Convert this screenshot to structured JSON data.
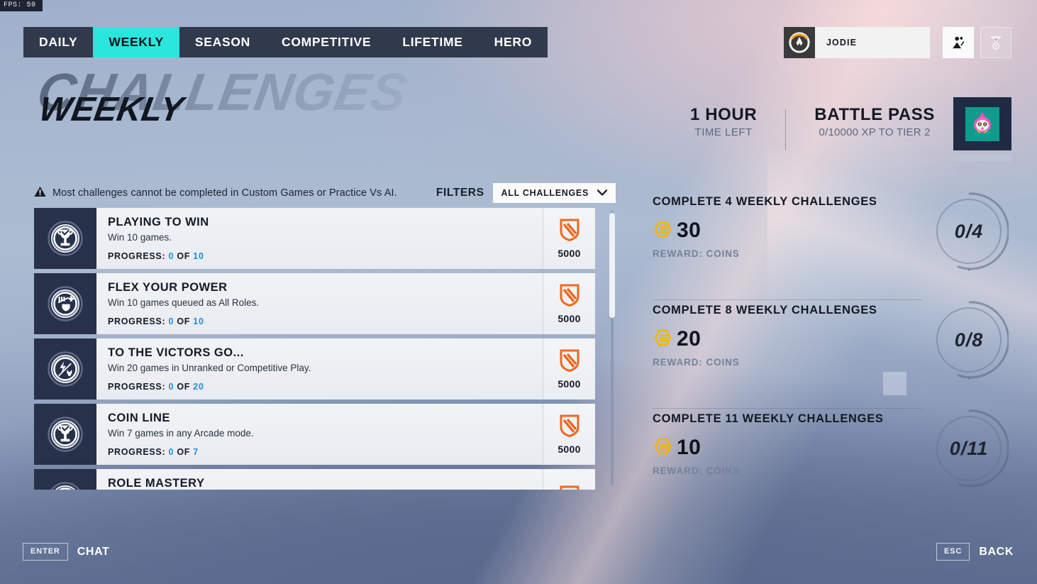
{
  "hud": {
    "fps_label": "FPS:",
    "fps_value": "59"
  },
  "tabs": [
    {
      "label": "DAILY",
      "active": false
    },
    {
      "label": "WEEKLY",
      "active": true
    },
    {
      "label": "SEASON",
      "active": false
    },
    {
      "label": "COMPETITIVE",
      "active": false
    },
    {
      "label": "LIFETIME",
      "active": false
    },
    {
      "label": "HERO",
      "active": false
    }
  ],
  "player": {
    "name": "JODIE",
    "logo_icon": "overwatch-logo-icon",
    "social_icon": "social-group-icon",
    "endorsement_icon": "endorsement-icon"
  },
  "title": {
    "ghost": "CHALLENGES",
    "main": "WEEKLY"
  },
  "header_right": {
    "time_value": "1 HOUR",
    "time_label": "TIME LEFT",
    "battlepass_title": "BATTLE PASS",
    "battlepass_sub": "0/10000 XP TO TIER 2"
  },
  "notice": {
    "icon": "warning-triangle-icon",
    "text": "Most challenges cannot be completed in Custom Games or Practice Vs AI."
  },
  "filters": {
    "label": "FILTERS",
    "selected": "ALL CHALLENGES",
    "chevron_icon": "chevron-down-icon"
  },
  "challenges": [
    {
      "icon": "trophy-icon",
      "title": "PLAYING TO WIN",
      "desc": "Win 10 games.",
      "progress_label": "PROGRESS:",
      "progress_current": "0",
      "progress_of": "OF",
      "progress_total": "10",
      "reward_icon": "xp-shield-icon",
      "reward_value": "5000"
    },
    {
      "icon": "all-roles-icon",
      "title": "FLEX YOUR POWER",
      "desc": "Win 10 games queued as All Roles.",
      "progress_label": "PROGRESS:",
      "progress_current": "0",
      "progress_of": "OF",
      "progress_total": "10",
      "reward_icon": "xp-shield-icon",
      "reward_value": "5000"
    },
    {
      "icon": "competitive-bolt-icon",
      "title": "TO THE VICTORS GO...",
      "desc": "Win 20 games in Unranked or Competitive Play.",
      "progress_label": "PROGRESS:",
      "progress_current": "0",
      "progress_of": "OF",
      "progress_total": "20",
      "reward_icon": "xp-shield-icon",
      "reward_value": "5000"
    },
    {
      "icon": "trophy-icon",
      "title": "COIN LINE",
      "desc": "Win 7 games in any Arcade mode.",
      "progress_label": "PROGRESS:",
      "progress_current": "0",
      "progress_of": "OF",
      "progress_total": "7",
      "reward_icon": "xp-shield-icon",
      "reward_value": "5000"
    },
    {
      "icon": "trophy-icon",
      "title": "ROLE MASTERY",
      "desc": "",
      "progress_label": "PROGRESS:",
      "progress_current": "",
      "progress_of": "",
      "progress_total": "",
      "reward_icon": "xp-shield-icon",
      "reward_value": ""
    }
  ],
  "reward_tiers": [
    {
      "title": "COMPLETE 4 WEEKLY CHALLENGES",
      "coin_icon": "coin-icon",
      "amount": "30",
      "reward_label": "REWARD:  COINS",
      "fraction": "0/4"
    },
    {
      "title": "COMPLETE 8 WEEKLY CHALLENGES",
      "coin_icon": "coin-icon",
      "amount": "20",
      "reward_label": "REWARD:  COINS",
      "fraction": "0/8"
    },
    {
      "title": "COMPLETE 11 WEEKLY CHALLENGES",
      "coin_icon": "coin-icon",
      "amount": "10",
      "reward_label": "REWARD:  COINS",
      "fraction": "0/11"
    }
  ],
  "footer": {
    "chat_key": "ENTER",
    "chat_label": "CHAT",
    "back_key": "ESC",
    "back_label": "BACK"
  },
  "colors": {
    "accent_cyan": "#2ae6dd",
    "progress_blue": "#1d8fe0",
    "coin_gold": "#f5b400",
    "xp_orange": "#ef6820",
    "panel_dark": "#27314a",
    "tabbar_dark": "#313a4c"
  }
}
